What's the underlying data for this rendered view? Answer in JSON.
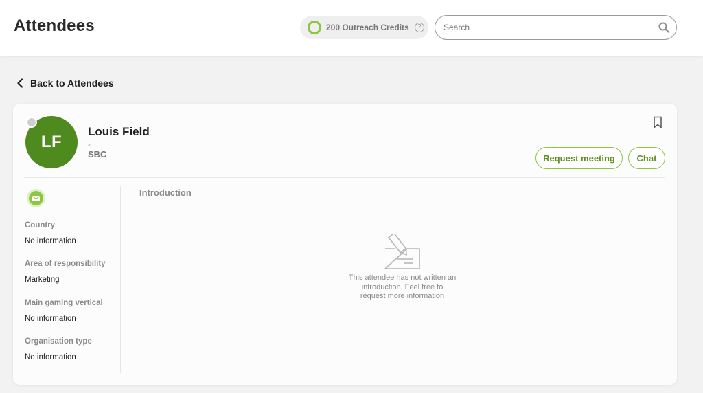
{
  "header": {
    "title": "Attendees",
    "credits_label": "200 Outreach Credits",
    "help_symbol": "?",
    "search_placeholder": "Search"
  },
  "nav": {
    "back_label": "Back to Attendees"
  },
  "profile": {
    "initials": "LF",
    "name": "Louis Field",
    "job_title": "-",
    "company": "SBC",
    "avatar_color": "#4f8a1f",
    "status_color": "#cfcfcf",
    "request_meeting_label": "Request meeting",
    "chat_label": "Chat"
  },
  "details": [
    {
      "label": "Country",
      "value": "No information"
    },
    {
      "label": "Area of responsibility",
      "value": "Marketing"
    },
    {
      "label": "Main gaming vertical",
      "value": "No information"
    },
    {
      "label": "Organisation type",
      "value": "No information"
    }
  ],
  "introduction": {
    "title": "Introduction",
    "empty_line1": "This attendee has not written an",
    "empty_line2": "introduction. Feel free to",
    "empty_line3": "request more information"
  },
  "colors": {
    "accent": "#8dc63f",
    "accent_text": "#5f8f22"
  },
  "icons": {
    "back": "chevron-left-icon",
    "search": "search-icon",
    "help": "help-circle-icon",
    "bookmark": "bookmark-icon",
    "email": "envelope-icon",
    "empty_state": "edit-document-icon"
  }
}
